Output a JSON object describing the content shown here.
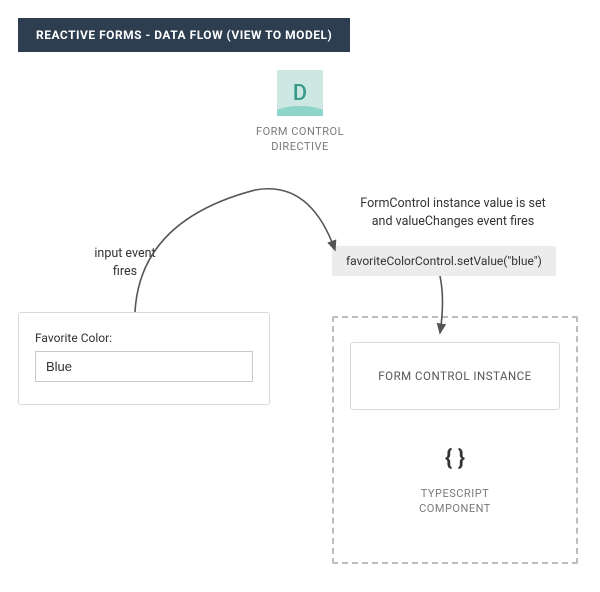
{
  "title": "REACTIVE FORMS - DATA FLOW (VIEW TO MODEL)",
  "directive": {
    "letter": "D",
    "label_line1": "FORM CONTROL",
    "label_line2": "DIRECTIVE"
  },
  "annotation_right_line1": "FormControl instance value is set",
  "annotation_right_line2": "and valueChanges event fires",
  "code_snippet": "favoriteColorControl.setValue(\"blue\")",
  "annotation_left_line1": "input event",
  "annotation_left_line2": "fires",
  "form": {
    "label": "Favorite Color:",
    "value": "Blue"
  },
  "instance_label": "FORM CONTROL INSTANCE",
  "braces_glyph": "{ }",
  "ts_label_line1": "TYPESCRIPT",
  "ts_label_line2": "COMPONENT"
}
